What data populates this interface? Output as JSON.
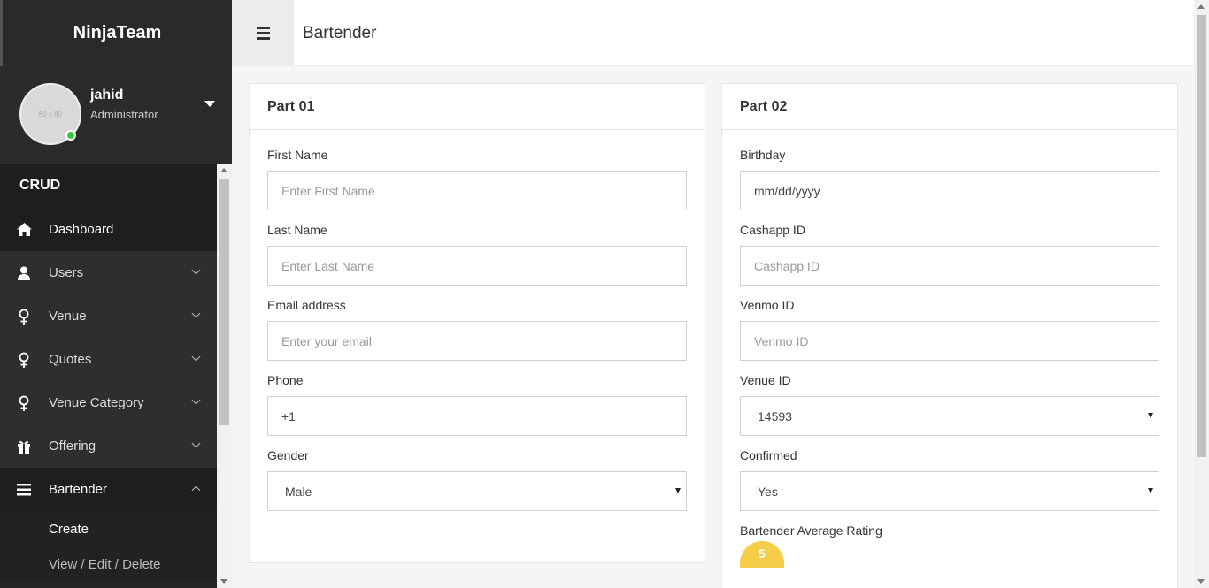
{
  "app": {
    "brand": "NinjaTeam"
  },
  "profile": {
    "name": "jahid",
    "role": "Administrator",
    "avatar_placeholder": "80 x 80",
    "online_color": "#2ecc40"
  },
  "sidebar": {
    "section": "CRUD",
    "items": [
      {
        "label": "Dashboard",
        "icon": "home-icon"
      },
      {
        "label": "Users",
        "icon": "user-icon"
      },
      {
        "label": "Venue",
        "icon": "female-icon"
      },
      {
        "label": "Quotes",
        "icon": "female-icon"
      },
      {
        "label": "Venue Category",
        "icon": "female-icon"
      },
      {
        "label": "Offering",
        "icon": "gift-icon"
      },
      {
        "label": "Bartender",
        "icon": "bars-icon"
      }
    ],
    "submenu": [
      {
        "label": "Create"
      },
      {
        "label": "View / Edit / Delete"
      }
    ]
  },
  "topbar": {
    "title": "Bartender"
  },
  "part1": {
    "title": "Part 01",
    "first_name": {
      "label": "First Name",
      "placeholder": "Enter First Name"
    },
    "last_name": {
      "label": "Last Name",
      "placeholder": "Enter Last Name"
    },
    "email": {
      "label": "Email address",
      "placeholder": "Enter your email"
    },
    "phone": {
      "label": "Phone",
      "value": "+1"
    },
    "gender": {
      "label": "Gender",
      "value": "Male"
    }
  },
  "part2": {
    "title": "Part 02",
    "birthday": {
      "label": "Birthday",
      "value": "mm/dd/yyyy"
    },
    "cashapp": {
      "label": "Cashapp ID",
      "placeholder": "Cashapp ID"
    },
    "venmo": {
      "label": "Venmo ID",
      "placeholder": "Venmo ID"
    },
    "venue_id": {
      "label": "Venue ID",
      "value": "14593"
    },
    "confirmed": {
      "label": "Confirmed",
      "value": "Yes"
    },
    "rating": {
      "label": "Bartender Average Rating",
      "value": "5"
    }
  },
  "colors": {
    "sidebar_bg": "#2a2a2a",
    "rating": "#f5cd48"
  }
}
